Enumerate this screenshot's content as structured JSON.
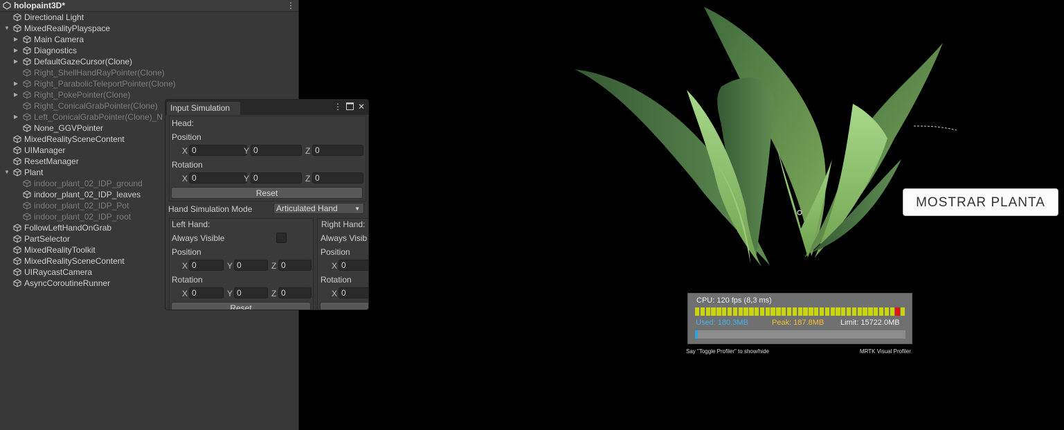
{
  "hierarchy": {
    "scene_title": "holopaint3D*",
    "items": [
      {
        "label": "Directional Light",
        "depth": 0,
        "arrow": "",
        "dim": false
      },
      {
        "label": "MixedRealityPlayspace",
        "depth": 0,
        "arrow": "expanded",
        "dim": false
      },
      {
        "label": "Main Camera",
        "depth": 1,
        "arrow": "collapsed",
        "dim": false
      },
      {
        "label": "Diagnostics",
        "depth": 1,
        "arrow": "collapsed",
        "dim": false
      },
      {
        "label": "DefaultGazeCursor(Clone)",
        "depth": 1,
        "arrow": "collapsed",
        "dim": false
      },
      {
        "label": "Right_ShellHandRayPointer(Clone)",
        "depth": 1,
        "arrow": "",
        "dim": true
      },
      {
        "label": "Right_ParabolicTeleportPointer(Clone)",
        "depth": 1,
        "arrow": "collapsed",
        "dim": true
      },
      {
        "label": "Right_PokePointer(Clone)",
        "depth": 1,
        "arrow": "collapsed",
        "dim": true
      },
      {
        "label": "Right_ConicalGrabPointer(Clone)",
        "depth": 1,
        "arrow": "",
        "dim": true
      },
      {
        "label": "Left_ConicalGrabPointer(Clone)_N",
        "depth": 1,
        "arrow": "collapsed",
        "dim": true
      },
      {
        "label": "None_GGVPointer",
        "depth": 1,
        "arrow": "",
        "dim": false
      },
      {
        "label": "MixedRealitySceneContent",
        "depth": 0,
        "arrow": "",
        "dim": false
      },
      {
        "label": "UIManager",
        "depth": 0,
        "arrow": "",
        "dim": false
      },
      {
        "label": "ResetManager",
        "depth": 0,
        "arrow": "",
        "dim": false
      },
      {
        "label": "Plant",
        "depth": 0,
        "arrow": "expanded",
        "dim": false
      },
      {
        "label": "indoor_plant_02_IDP_ground",
        "depth": 1,
        "arrow": "",
        "dim": true
      },
      {
        "label": "indoor_plant_02_IDP_leaves",
        "depth": 1,
        "arrow": "",
        "dim": false
      },
      {
        "label": "indoor_plant_02_IDP_Pot",
        "depth": 1,
        "arrow": "",
        "dim": true
      },
      {
        "label": "indoor_plant_02_IDP_root",
        "depth": 1,
        "arrow": "",
        "dim": true
      },
      {
        "label": "FollowLeftHandOnGrab",
        "depth": 0,
        "arrow": "",
        "dim": false
      },
      {
        "label": "PartSelector",
        "depth": 0,
        "arrow": "",
        "dim": false
      },
      {
        "label": "MixedRealityToolkit",
        "depth": 0,
        "arrow": "",
        "dim": false
      },
      {
        "label": "MixedRealitySceneContent",
        "depth": 0,
        "arrow": "",
        "dim": false
      },
      {
        "label": "UIRaycastCamera",
        "depth": 0,
        "arrow": "",
        "dim": false
      },
      {
        "label": "AsyncCoroutineRunner",
        "depth": 0,
        "arrow": "",
        "dim": false
      }
    ]
  },
  "input_simulation": {
    "tab_label": "Input Simulation",
    "head_label": "Head:",
    "position_label": "Position",
    "rotation_label": "Rotation",
    "axis_x": "X",
    "axis_y": "Y",
    "axis_z": "Z",
    "head_position": [
      "0",
      "0",
      "0"
    ],
    "head_rotation": [
      "0",
      "0",
      "0"
    ],
    "reset_label": "Reset",
    "hand_mode_label": "Hand Simulation Mode",
    "hand_mode_value": "Articulated Hand",
    "left_hand_label": "Left Hand:",
    "right_hand_label": "Right Hand:",
    "always_visible_label": "Always Visible",
    "right_always_visible_label": "Always Visib",
    "left_position": [
      "0",
      "0",
      "0"
    ],
    "left_rotation": [
      "0",
      "0",
      "0"
    ],
    "right_position_x": "0",
    "right_rotation_x": "0"
  },
  "viewport": {
    "mostrar_button": "MOSTRAR PLANTA",
    "profiler": {
      "cpu": "CPU: 120 fps (8,3 ms)",
      "used": "Used: 180.3MB",
      "peak": "Peak: 187.8MB",
      "limit": "Limit: 15722.0MB",
      "memory_fraction": 0.012,
      "frame_states": [
        "ok",
        "ok",
        "ok",
        "ok",
        "ok",
        "ok",
        "ok",
        "ok",
        "ok",
        "ok",
        "ok",
        "ok",
        "ok",
        "ok",
        "ok",
        "ok",
        "ok",
        "ok",
        "ok",
        "ok",
        "ok",
        "ok",
        "ok",
        "ok",
        "ok",
        "ok",
        "ok",
        "ok",
        "ok",
        "ok",
        "ok",
        "ok",
        "ok",
        "ok",
        "ok",
        "ok",
        "ok",
        "slow",
        "ok"
      ],
      "footer_left": "Say \"Toggle Profiler\" to show/hide",
      "footer_right": "MRTK Visual Profiler"
    }
  },
  "colors": {
    "used": "#3fb4f0",
    "peak": "#f2c12e",
    "limit": "#f2f2f2",
    "frame_ok": "#c9d60f",
    "frame_slow": "#e01515"
  }
}
